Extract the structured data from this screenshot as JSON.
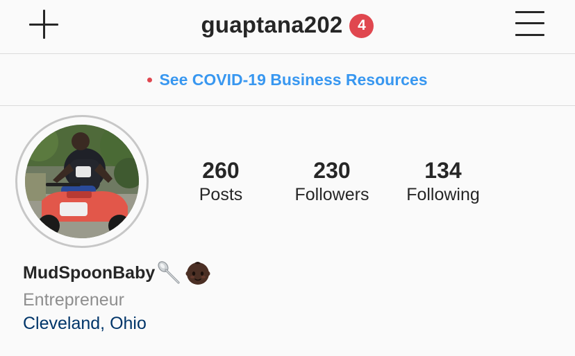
{
  "header": {
    "username": "guaptana202",
    "notification_count": "4",
    "new_post_icon": "plus-icon",
    "menu_icon": "hamburger-menu-icon"
  },
  "banner": {
    "text": "See COVID-19 Business Resources",
    "dot_color": "#e0474f",
    "link_color": "#3897f0"
  },
  "profile": {
    "stats": [
      {
        "value": "260",
        "label": "Posts"
      },
      {
        "value": "230",
        "label": "Followers"
      },
      {
        "value": "134",
        "label": "Following"
      }
    ],
    "name": "MudSpoonBaby",
    "name_emojis": [
      "spoon-emoji",
      "baby-emoji"
    ],
    "category": "Entrepreneur",
    "location": "Cleveland, Ohio"
  },
  "colors": {
    "badge": "#e0474f",
    "location_link": "#003569",
    "category": "#8e8e8e"
  }
}
